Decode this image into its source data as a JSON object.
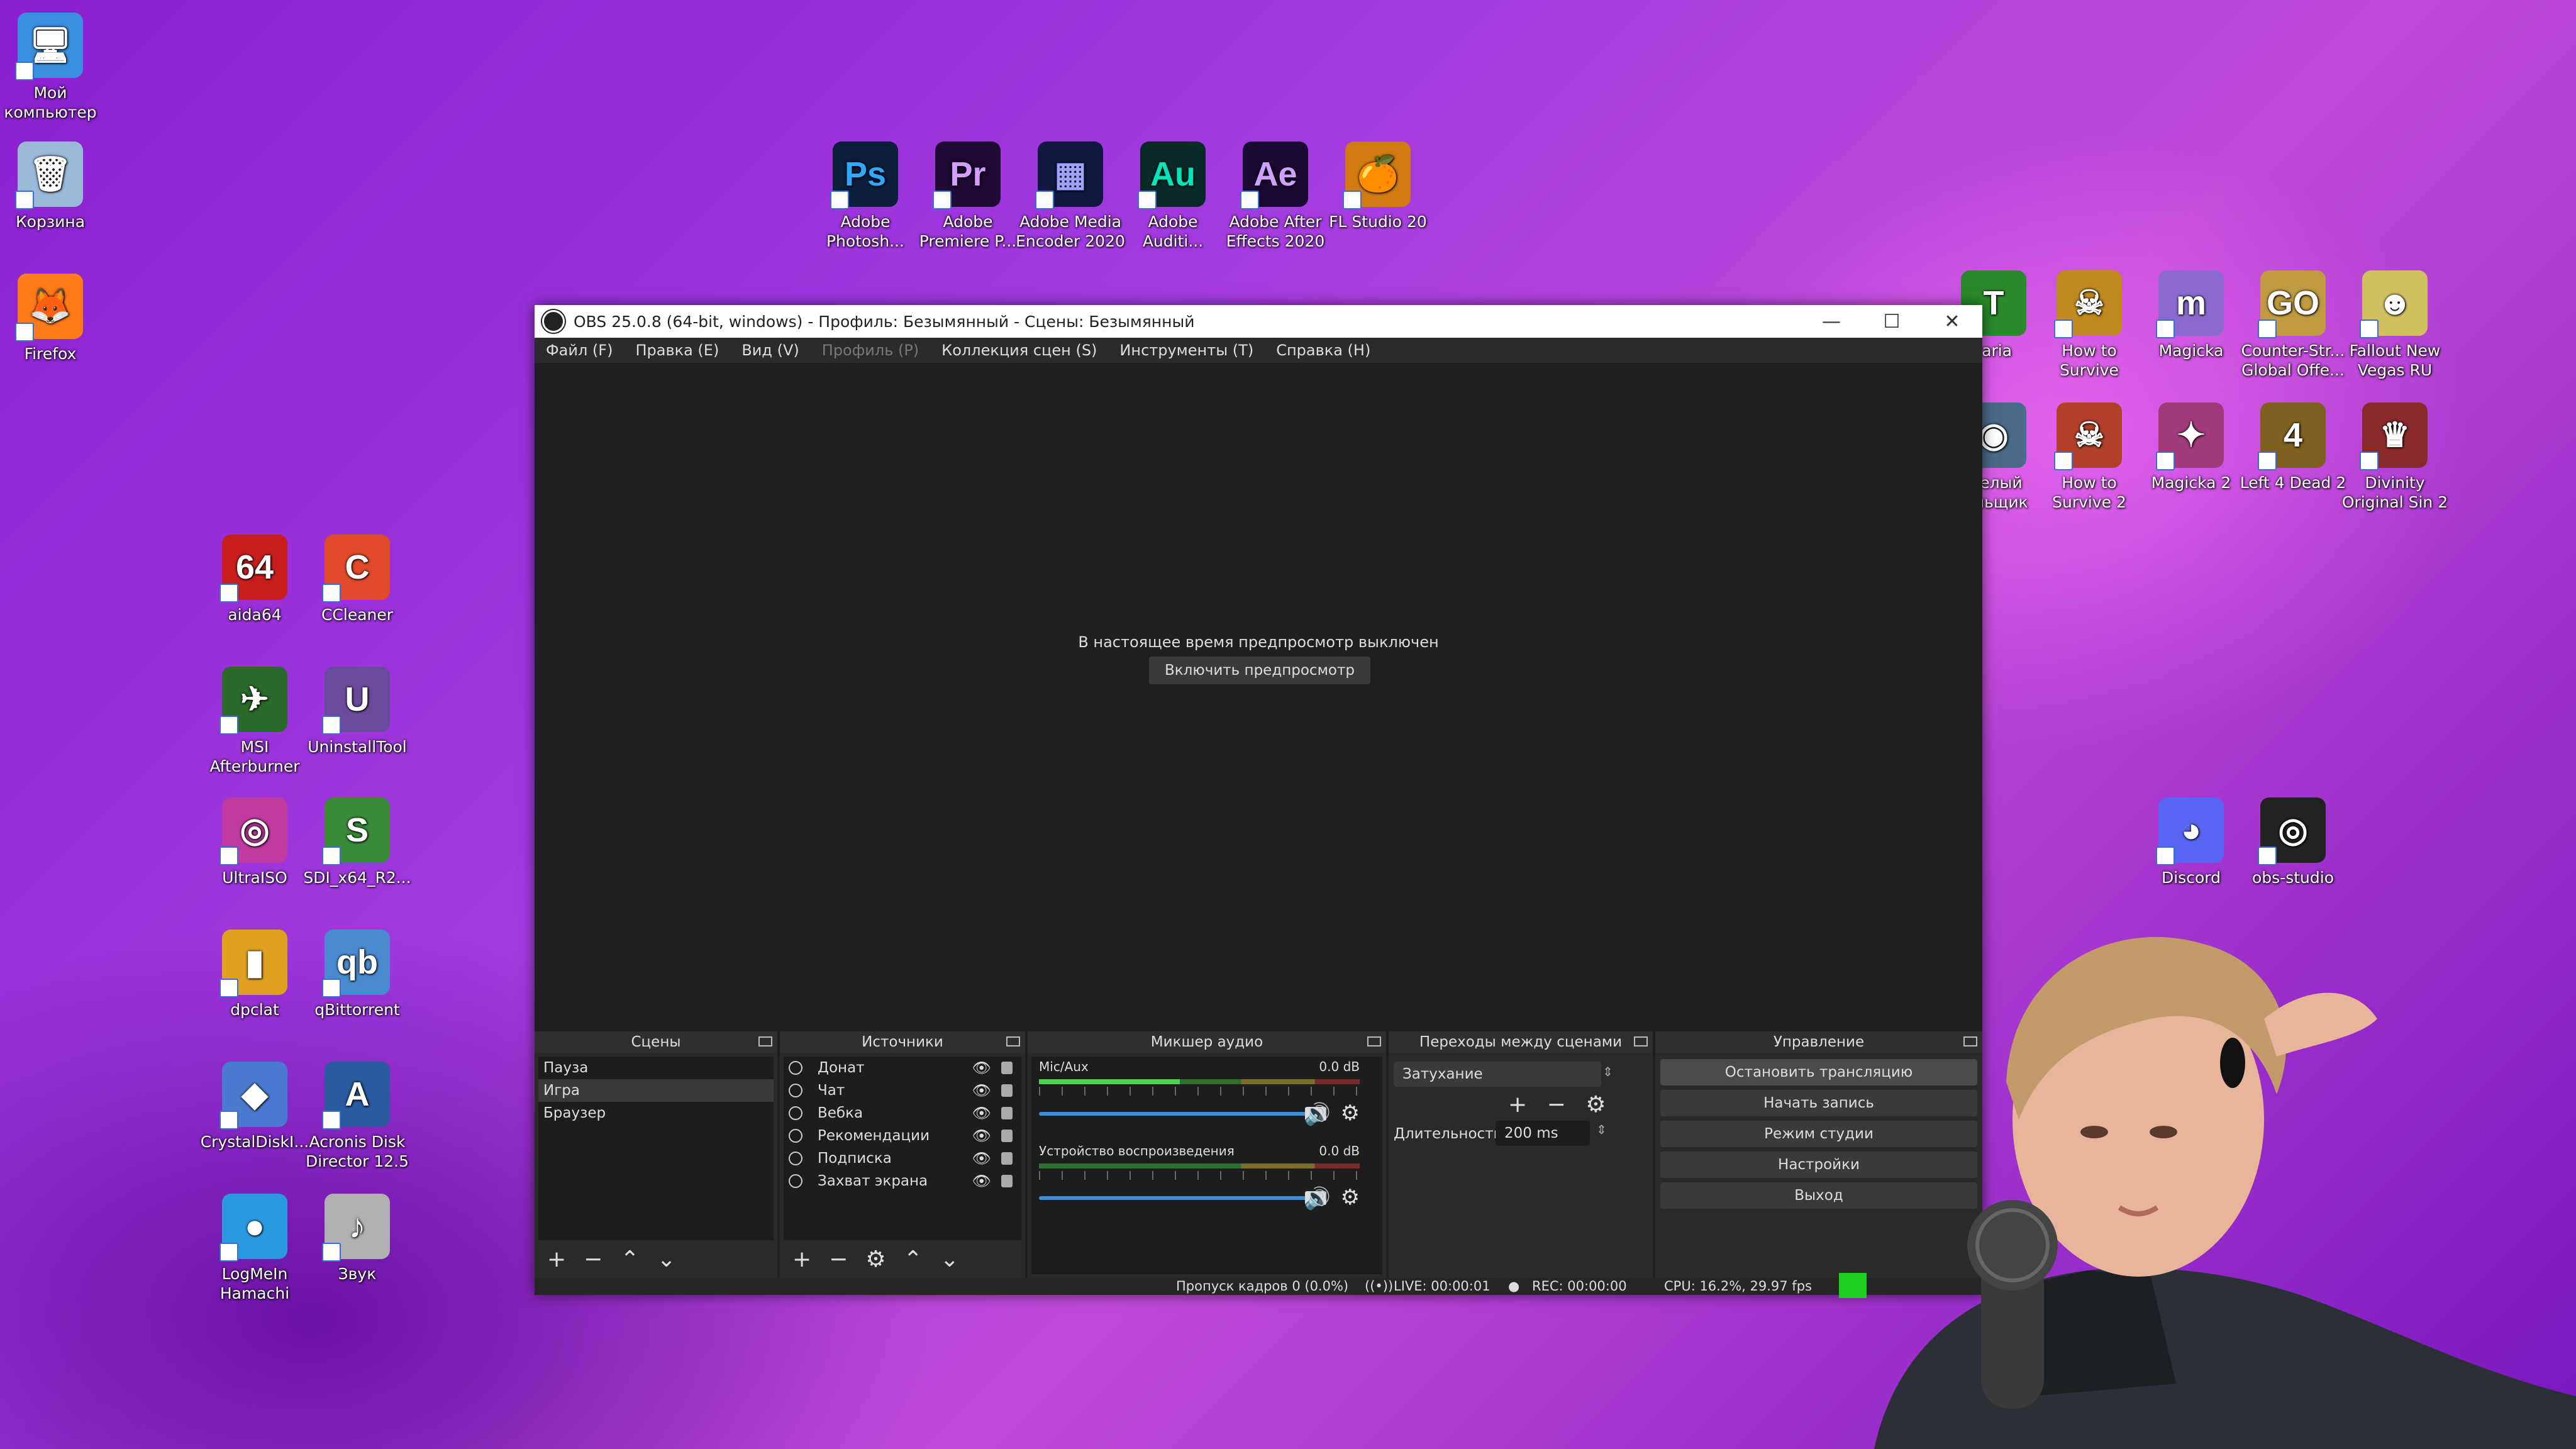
{
  "desktop": {
    "icons_left": [
      {
        "label": "Мой компьютер",
        "color": "#3a8fe0",
        "glyph": "🖥"
      },
      {
        "label": "Корзина",
        "color": "#9ab8d8",
        "glyph": "🗑"
      },
      {
        "label": "Firefox",
        "color": "#ff7a18",
        "glyph": "🦊"
      },
      {
        "label": "aida64",
        "color": "#c81e1e",
        "glyph": "64"
      },
      {
        "label": "CCleaner",
        "color": "#e04a2a",
        "glyph": "C"
      },
      {
        "label": "MSI Afterburner",
        "color": "#2a6a2a",
        "glyph": "✈"
      },
      {
        "label": "UninstallTool",
        "color": "#6a4a9a",
        "glyph": "U"
      },
      {
        "label": "UltraISO",
        "color": "#c03aa0",
        "glyph": "◎"
      },
      {
        "label": "SDI_x64_R2...",
        "color": "#3a8a3a",
        "glyph": "S"
      },
      {
        "label": "dpclat",
        "color": "#e0a020",
        "glyph": "▮"
      },
      {
        "label": "qBittorrent",
        "color": "#4a8ad0",
        "glyph": "qb"
      },
      {
        "label": "CrystalDiskI...",
        "color": "#4a7ad0",
        "glyph": "◆"
      },
      {
        "label": "Acronis Disk Director 12.5",
        "color": "#2a5aa0",
        "glyph": "A"
      },
      {
        "label": "LogMeIn Hamachi",
        "color": "#2a9ae0",
        "glyph": "●"
      },
      {
        "label": "Звук",
        "color": "#b0b0b0",
        "glyph": "♪"
      }
    ],
    "icons_top": [
      {
        "label": "Adobe Photosh...",
        "color": "#0b1e3a",
        "fg": "#31a8ff",
        "glyph": "Ps"
      },
      {
        "label": "Adobe Premiere P...",
        "color": "#1f0a33",
        "fg": "#d69bff",
        "glyph": "Pr"
      },
      {
        "label": "Adobe Media Encoder 2020",
        "color": "#101840",
        "fg": "#a0a0ff",
        "glyph": "▦"
      },
      {
        "label": "Adobe Auditi...",
        "color": "#0a2a28",
        "fg": "#00e4bb",
        "glyph": "Au"
      },
      {
        "label": "Adobe After Effects 2020",
        "color": "#1a0a33",
        "fg": "#d0a0ff",
        "glyph": "Ae"
      },
      {
        "label": "FL Studio 20",
        "color": "#d07a10",
        "fg": "#fff",
        "glyph": "🍊"
      }
    ],
    "icons_right": [
      {
        "label": "raria",
        "color": "#2a8a2a",
        "glyph": "T"
      },
      {
        "label": "How to Survive",
        "color": "#c08a20",
        "glyph": "☠"
      },
      {
        "label": "Magicka",
        "color": "#8a6ad0",
        "glyph": "m"
      },
      {
        "label": "Counter-Str... Global Offe...",
        "color": "#c09a40",
        "glyph": "GO"
      },
      {
        "label": "Fallout New Vegas RU",
        "color": "#d0c060",
        "glyph": "☻"
      },
      {
        "label": "...елый ...льщик",
        "color": "#4a6a8a",
        "glyph": "◉"
      },
      {
        "label": "How to Survive 2",
        "color": "#b0402a",
        "glyph": "☠"
      },
      {
        "label": "Magicka 2",
        "color": "#a03a7a",
        "glyph": "✦"
      },
      {
        "label": "Left 4 Dead 2",
        "color": "#806020",
        "glyph": "4"
      },
      {
        "label": "Divinity Original Sin 2",
        "color": "#8a2a2a",
        "glyph": "♛"
      },
      {
        "label": "Discord",
        "color": "#5865f2",
        "glyph": "◕"
      },
      {
        "label": "obs-studio",
        "color": "#222",
        "glyph": "◎"
      }
    ]
  },
  "obs": {
    "title": "OBS 25.0.8 (64-bit, windows) - Профиль: Безымянный - Сцены: Безымянный",
    "menu": [
      {
        "label": "Файл (F)",
        "disabled": false
      },
      {
        "label": "Правка (E)",
        "disabled": false
      },
      {
        "label": "Вид (V)",
        "disabled": false
      },
      {
        "label": "Профиль (P)",
        "disabled": true
      },
      {
        "label": "Коллекция сцен (S)",
        "disabled": false
      },
      {
        "label": "Инструменты (T)",
        "disabled": false
      },
      {
        "label": "Справка (H)",
        "disabled": false
      }
    ],
    "preview": {
      "message": "В настоящее время предпросмотр выключен",
      "enable_button": "Включить предпросмотр"
    },
    "scenes": {
      "title": "Сцены",
      "items": [
        "Пауза",
        "Игра",
        "Браузер"
      ],
      "selected_index": 1
    },
    "sources": {
      "title": "Источники",
      "items": [
        "Донат",
        "Чат",
        "Вебка",
        "Рекомендации",
        "Подписка",
        "Захват экрана"
      ]
    },
    "mixer": {
      "title": "Микшер аудио",
      "channels": [
        {
          "name": "Mic/Aux",
          "db": "0.0 dB",
          "level": 0.44,
          "volume": 1.0
        },
        {
          "name": "Устройство воспроизведения",
          "db": "0.0 dB",
          "level": 0.0,
          "volume": 1.0
        }
      ]
    },
    "transitions": {
      "title": "Переходы между сценами",
      "selected": "Затухание",
      "duration_label": "Длительность",
      "duration_value": "200 ms"
    },
    "controls": {
      "title": "Управление",
      "buttons": [
        "Остановить трансляцию",
        "Начать запись",
        "Режим студии",
        "Настройки",
        "Выход"
      ]
    },
    "status": {
      "dropped": "Пропуск кадров 0 (0.0%)",
      "live": "LIVE: 00:00:01",
      "rec": "REC: 00:00:00",
      "cpu": "CPU: 16.2%, 29.97 fps",
      "indicator_color": "#1fd11f"
    }
  }
}
